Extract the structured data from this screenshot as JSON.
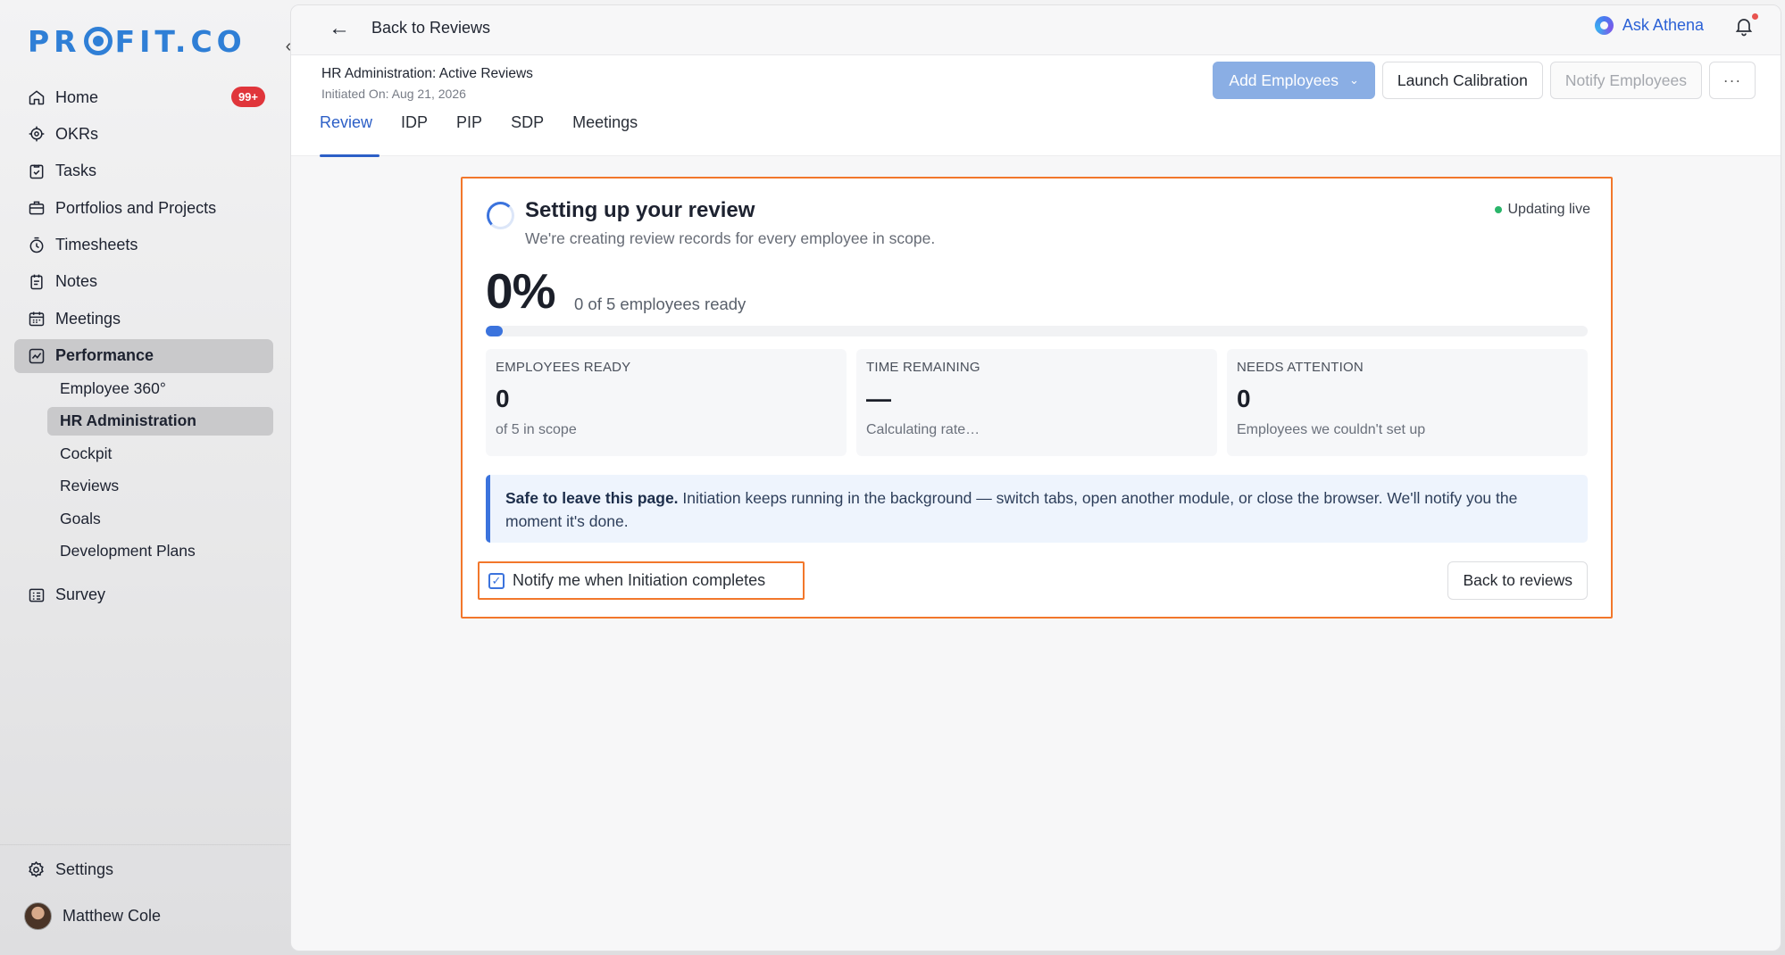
{
  "brand": {
    "logo_text": "PROFIT.CO",
    "accent": "#2f7fd6",
    "highlight": "#f2772b"
  },
  "sidebar": {
    "items": [
      {
        "label": "Home",
        "icon": "home-icon",
        "badge": "99+"
      },
      {
        "label": "OKRs",
        "icon": "target-icon"
      },
      {
        "label": "Tasks",
        "icon": "tasks-icon"
      },
      {
        "label": "Portfolios and Projects",
        "icon": "briefcase-icon"
      },
      {
        "label": "Timesheets",
        "icon": "timer-icon"
      },
      {
        "label": "Notes",
        "icon": "notes-icon"
      },
      {
        "label": "Meetings",
        "icon": "calendar-icon"
      },
      {
        "label": "Performance",
        "icon": "chart-line-icon",
        "active": true
      }
    ],
    "sub_items": [
      {
        "label": "Employee 360°"
      },
      {
        "label": "HR Administration",
        "active": true
      },
      {
        "label": "Cockpit"
      },
      {
        "label": "Reviews"
      },
      {
        "label": "Goals"
      },
      {
        "label": "Development Plans"
      }
    ],
    "survey": "Survey",
    "settings": "Settings",
    "user_name": "Matthew Cole"
  },
  "topbar": {
    "back_label": "Back to Reviews",
    "ask_athena": "Ask Athena"
  },
  "header": {
    "title": "HR Administration: Active Reviews",
    "subtitle": "Initiated On: Aug 21, 2026",
    "add_employees": "Add Employees",
    "launch_calibration": "Launch Calibration",
    "notify_employees": "Notify Employees",
    "more": "···",
    "tabs": [
      "Review",
      "IDP",
      "PIP",
      "SDP",
      "Meetings"
    ]
  },
  "setup": {
    "title": "Setting up your review",
    "subtitle": "We're creating review records for every employee in scope.",
    "live": "Updating live",
    "percent": "0%",
    "progress_fraction": 0,
    "progress_label": "0 of 5 employees ready",
    "stats": [
      {
        "label": "EMPLOYEES READY",
        "value": "0",
        "desc": "of 5 in scope"
      },
      {
        "label": "TIME REMAINING",
        "value": "—",
        "desc": "Calculating rate…"
      },
      {
        "label": "NEEDS ATTENTION",
        "value": "0",
        "desc": "Employees we couldn't set up"
      }
    ],
    "info_bold": "Safe to leave this page.",
    "info_text": " Initiation keeps running in the background — switch tabs, open another module, or close the browser. We'll notify you the moment it's done.",
    "notify_label": "Notify me when Initiation completes",
    "notify_checked": true,
    "back_button": "Back to reviews"
  }
}
